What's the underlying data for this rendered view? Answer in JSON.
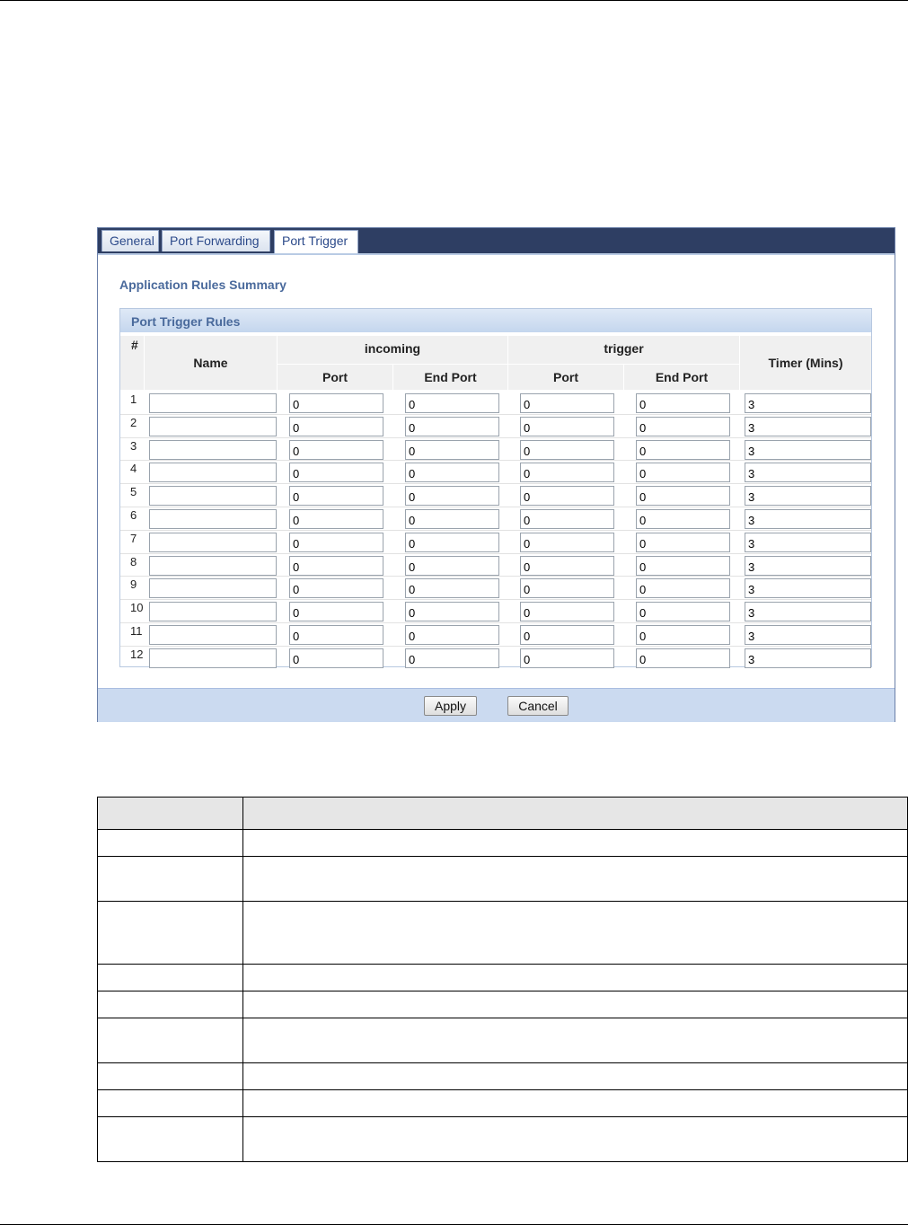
{
  "tabs": [
    {
      "label": "General",
      "active": false
    },
    {
      "label": "Port Forwarding",
      "active": false
    },
    {
      "label": "Port Trigger",
      "active": true
    }
  ],
  "summary_title": "Application Rules Summary",
  "rules_header": "Port Trigger Rules",
  "columns": {
    "hash": "#",
    "name": "Name",
    "incoming": "incoming",
    "trigger": "trigger",
    "port": "Port",
    "end_port": "End Port",
    "timer": "Timer (Mins)"
  },
  "rows": [
    {
      "num": "1",
      "name": "",
      "in_port": "0",
      "in_end": "0",
      "tr_port": "0",
      "tr_end": "0",
      "timer": "3"
    },
    {
      "num": "2",
      "name": "",
      "in_port": "0",
      "in_end": "0",
      "tr_port": "0",
      "tr_end": "0",
      "timer": "3"
    },
    {
      "num": "3",
      "name": "",
      "in_port": "0",
      "in_end": "0",
      "tr_port": "0",
      "tr_end": "0",
      "timer": "3"
    },
    {
      "num": "4",
      "name": "",
      "in_port": "0",
      "in_end": "0",
      "tr_port": "0",
      "tr_end": "0",
      "timer": "3"
    },
    {
      "num": "5",
      "name": "",
      "in_port": "0",
      "in_end": "0",
      "tr_port": "0",
      "tr_end": "0",
      "timer": "3"
    },
    {
      "num": "6",
      "name": "",
      "in_port": "0",
      "in_end": "0",
      "tr_port": "0",
      "tr_end": "0",
      "timer": "3"
    },
    {
      "num": "7",
      "name": "",
      "in_port": "0",
      "in_end": "0",
      "tr_port": "0",
      "tr_end": "0",
      "timer": "3"
    },
    {
      "num": "8",
      "name": "",
      "in_port": "0",
      "in_end": "0",
      "tr_port": "0",
      "tr_end": "0",
      "timer": "3"
    },
    {
      "num": "9",
      "name": "",
      "in_port": "0",
      "in_end": "0",
      "tr_port": "0",
      "tr_end": "0",
      "timer": "3"
    },
    {
      "num": "10",
      "name": "",
      "in_port": "0",
      "in_end": "0",
      "tr_port": "0",
      "tr_end": "0",
      "timer": "3"
    },
    {
      "num": "11",
      "name": "",
      "in_port": "0",
      "in_end": "0",
      "tr_port": "0",
      "tr_end": "0",
      "timer": "3"
    },
    {
      "num": "12",
      "name": "",
      "in_port": "0",
      "in_end": "0",
      "tr_port": "0",
      "tr_end": "0",
      "timer": "3"
    }
  ],
  "buttons": {
    "apply": "Apply",
    "cancel": "Cancel"
  },
  "colors": {
    "tabbar": "#2e3e63",
    "accent_text": "#4a6a9c",
    "footer": "#cbdaf0"
  }
}
